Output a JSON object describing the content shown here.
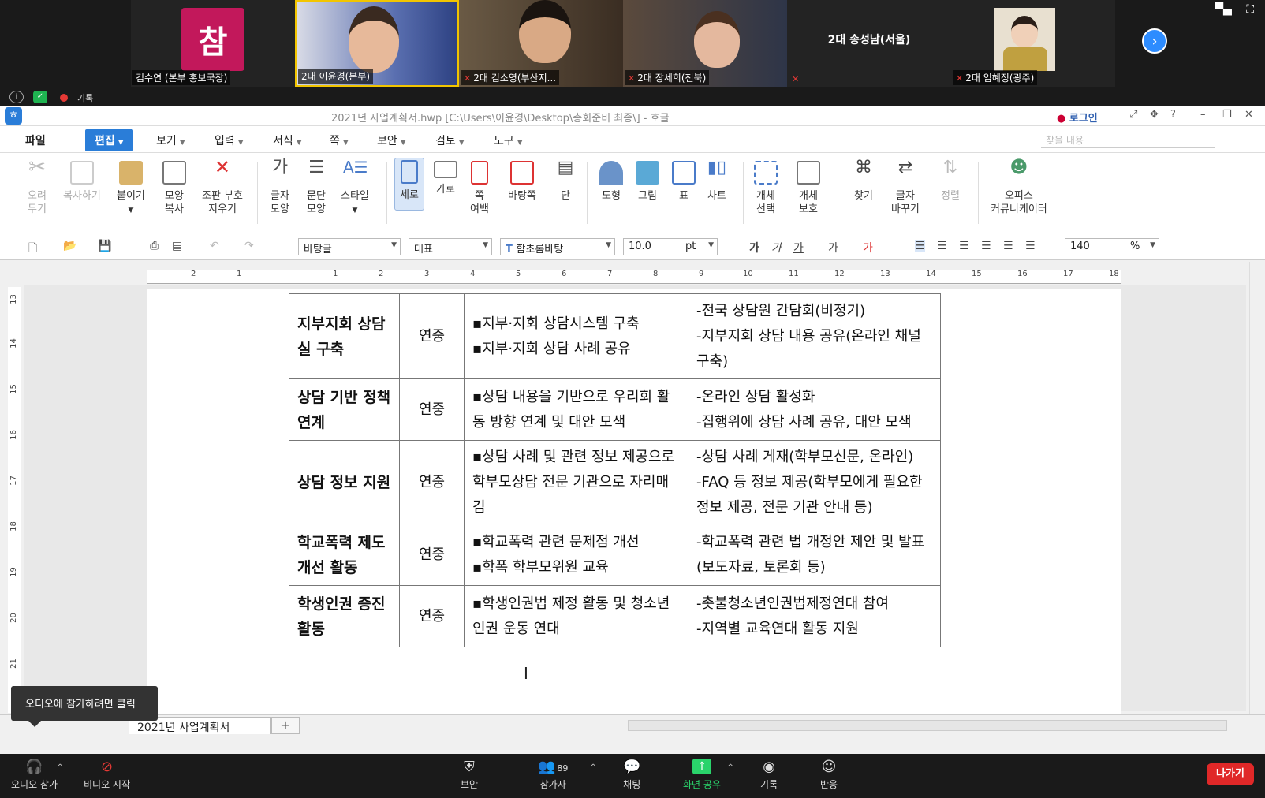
{
  "gallery": {
    "tiles": [
      {
        "name": "김수연 (본부 홍보국장)",
        "logo_text": "참",
        "muted": false
      },
      {
        "name": "2대 이윤경(본부)",
        "muted": false
      },
      {
        "name": "2대 김소영(부산지...",
        "muted": true
      },
      {
        "name": "2대 장세희(전북)",
        "muted": true
      },
      {
        "name": "2대 송성남(서울)",
        "muted": true
      },
      {
        "name": "2대 임혜정(광주)",
        "muted": true
      }
    ]
  },
  "status": {
    "recording_label": "기록"
  },
  "window": {
    "title": "2021년 사업계획서.hwp [C:\\Users\\이윤경\\Desktop\\총회준비 최종\\] - 호글",
    "login_label": "로그인"
  },
  "menu": {
    "items": [
      "파일",
      "편집",
      "보기",
      "입력",
      "서식",
      "쪽",
      "보안",
      "검토",
      "도구"
    ],
    "search_placeholder": "찾을 내용"
  },
  "ribbon": {
    "cut": [
      "오려",
      "두기"
    ],
    "copy": "복사하기",
    "paste": "붙이기",
    "format_copy": [
      "모양",
      "복사"
    ],
    "clear_marks": [
      "조판 부호",
      "지우기"
    ],
    "char_shape": [
      "글자",
      "모양"
    ],
    "para_shape": [
      "문단",
      "모양"
    ],
    "style": "스타일",
    "portrait": "세로",
    "landscape": "가로",
    "page_margin": [
      "쪽",
      "여백"
    ],
    "master_page": "바탕쪽",
    "columns": "단",
    "shape": "도형",
    "picture": "그림",
    "table": "표",
    "chart": "차트",
    "select_obj": [
      "개체",
      "선택"
    ],
    "protect_obj": [
      "개체",
      "보호"
    ],
    "find": "찾기",
    "replace": [
      "글자",
      "바꾸기"
    ],
    "sort": "정렬",
    "office_comm": [
      "오피스",
      "커뮤니케이터"
    ]
  },
  "format": {
    "style": "바탕글",
    "lang": "대표",
    "font": "함초롬바탕",
    "size": "10.0",
    "unit": "pt",
    "zoom": "140",
    "zoom_unit": "%"
  },
  "ruler": {
    "h_ticks": [
      "2",
      "1",
      "1",
      "2",
      "3",
      "4",
      "5",
      "6",
      "7",
      "8",
      "9",
      "10",
      "11",
      "12",
      "13",
      "14",
      "15",
      "16",
      "17",
      "18"
    ],
    "v_ticks": [
      "13",
      "14",
      "15",
      "16",
      "17",
      "18",
      "19",
      "20",
      "21"
    ]
  },
  "table": {
    "rows": [
      {
        "title": "지부지회 상담실 구축",
        "period": "연중",
        "tasks": [
          "▪지부·지회 상담시스템 구축",
          "▪지부·지회 상담 사례 공유"
        ],
        "details": [
          "-전국 상담원 간담회(비정기)",
          "-지부지회 상담 내용 공유(온라인 채널 구축)"
        ]
      },
      {
        "title": "상담 기반 정책 연계",
        "period": "연중",
        "tasks": [
          "▪상담 내용을 기반으로 우리회 활동 방향 연계 및 대안 모색"
        ],
        "details": [
          "-온라인 상담 활성화",
          "-집행위에 상담 사례 공유, 대안 모색"
        ]
      },
      {
        "title": "상담 정보 지원",
        "period": "연중",
        "tasks": [
          "▪상담 사례 및 관련 정보 제공으로 학부모상담 전문 기관으로 자리매김"
        ],
        "details": [
          "-상담 사례 게재(학부모신문, 온라인)",
          "-FAQ 등 정보 제공(학부모에게 필요한 정보 제공, 전문 기관 안내 등)"
        ]
      },
      {
        "title": "학교폭력 제도 개선 활동",
        "period": "연중",
        "tasks": [
          "▪학교폭력 관련 문제점 개선",
          "▪학폭 학부모위원 교육"
        ],
        "details": [
          "-학교폭력 관련 법 개정안 제안 및 발표(보도자료, 토론회 등)"
        ]
      },
      {
        "title": "학생인권 증진 활동",
        "period": "연중",
        "tasks": [
          "▪학생인권법 제정 활동 및 청소년인권 운동 연대"
        ],
        "details": [
          "-촛불청소년인권법제정연대 참여",
          "-지역별 교육연대 활동 지원"
        ]
      }
    ]
  },
  "tabs": {
    "doc_tab": "2021년 사업계획서",
    "add": "+"
  },
  "tooltip": "오디오에 참가하려면 클릭",
  "zoom": {
    "audio": "오디오 참가",
    "video": "비디오 시작",
    "security": "보안",
    "participants": "참가자",
    "participant_count": "89",
    "chat": "채팅",
    "share": "화면 공유",
    "record": "기록",
    "reactions": "반응",
    "leave": "나가기"
  }
}
